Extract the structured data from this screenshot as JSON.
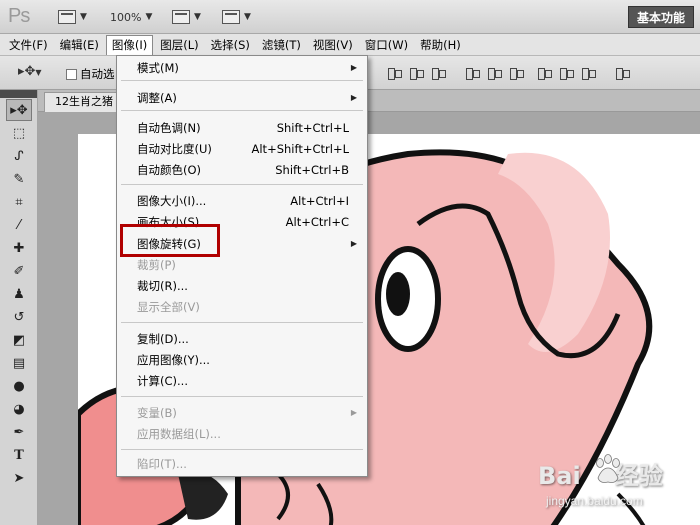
{
  "app": {
    "logo": "Ps",
    "zoom_level": "100%",
    "workspace_label": "基本功能"
  },
  "menubar": {
    "items": [
      {
        "label": "文件(F)"
      },
      {
        "label": "编辑(E)"
      },
      {
        "label": "图像(I)",
        "active": true
      },
      {
        "label": "图层(L)"
      },
      {
        "label": "选择(S)"
      },
      {
        "label": "滤镜(T)"
      },
      {
        "label": "视图(V)"
      },
      {
        "label": "窗口(W)"
      },
      {
        "label": "帮助(H)"
      }
    ]
  },
  "options": {
    "auto_select_label": "自动选"
  },
  "document": {
    "tab_label": "12生肖之猪"
  },
  "image_menu": {
    "items": [
      {
        "label": "模式(M)",
        "shortcut": "",
        "submenu": true,
        "disabled": false
      },
      {
        "label": "调整(A)",
        "shortcut": "",
        "submenu": true,
        "disabled": false
      },
      {
        "label": "自动色调(N)",
        "shortcut": "Shift+Ctrl+L",
        "submenu": false,
        "disabled": false
      },
      {
        "label": "自动对比度(U)",
        "shortcut": "Alt+Shift+Ctrl+L",
        "submenu": false,
        "disabled": false
      },
      {
        "label": "自动颜色(O)",
        "shortcut": "Shift+Ctrl+B",
        "submenu": false,
        "disabled": false
      },
      {
        "label": "图像大小(I)...",
        "shortcut": "Alt+Ctrl+I",
        "submenu": false,
        "disabled": false
      },
      {
        "label": "画布大小(S)...",
        "shortcut": "Alt+Ctrl+C",
        "submenu": false,
        "disabled": false
      },
      {
        "label": "图像旋转(G)",
        "shortcut": "",
        "submenu": true,
        "disabled": false,
        "highlighted": true
      },
      {
        "label": "裁剪(P)",
        "shortcut": "",
        "submenu": false,
        "disabled": true
      },
      {
        "label": "裁切(R)...",
        "shortcut": "",
        "submenu": false,
        "disabled": false
      },
      {
        "label": "显示全部(V)",
        "shortcut": "",
        "submenu": false,
        "disabled": true
      },
      {
        "label": "复制(D)...",
        "shortcut": "",
        "submenu": false,
        "disabled": false
      },
      {
        "label": "应用图像(Y)...",
        "shortcut": "",
        "submenu": false,
        "disabled": false
      },
      {
        "label": "计算(C)...",
        "shortcut": "",
        "submenu": false,
        "disabled": false
      },
      {
        "label": "变量(B)",
        "shortcut": "",
        "submenu": true,
        "disabled": true
      },
      {
        "label": "应用数据组(L)...",
        "shortcut": "",
        "submenu": false,
        "disabled": true
      },
      {
        "label": "陷印(T)...",
        "shortcut": "",
        "submenu": false,
        "disabled": true
      }
    ],
    "highlight_color": "#b00000"
  },
  "toolbox": {
    "tools": [
      {
        "icon": "move-icon"
      },
      {
        "icon": "marquee-icon"
      },
      {
        "icon": "lasso-icon"
      },
      {
        "icon": "quick-select-icon"
      },
      {
        "icon": "crop-icon"
      },
      {
        "icon": "eyedropper-icon"
      },
      {
        "icon": "healing-brush-icon"
      },
      {
        "icon": "brush-icon"
      },
      {
        "icon": "clone-stamp-icon"
      },
      {
        "icon": "history-brush-icon"
      },
      {
        "icon": "eraser-icon"
      },
      {
        "icon": "gradient-icon"
      },
      {
        "icon": "blur-icon"
      },
      {
        "icon": "dodge-icon"
      },
      {
        "icon": "pen-icon"
      },
      {
        "icon": "type-icon"
      },
      {
        "icon": "path-select-icon"
      }
    ]
  },
  "watermark": {
    "brand": "Bai",
    "brand2": "经验",
    "url": "jingyan.baidu.com"
  },
  "colors": {
    "pig_pink": "#f4b8b8",
    "pig_light": "#f9d0d0",
    "menu_bg": "#f6f6f6"
  }
}
